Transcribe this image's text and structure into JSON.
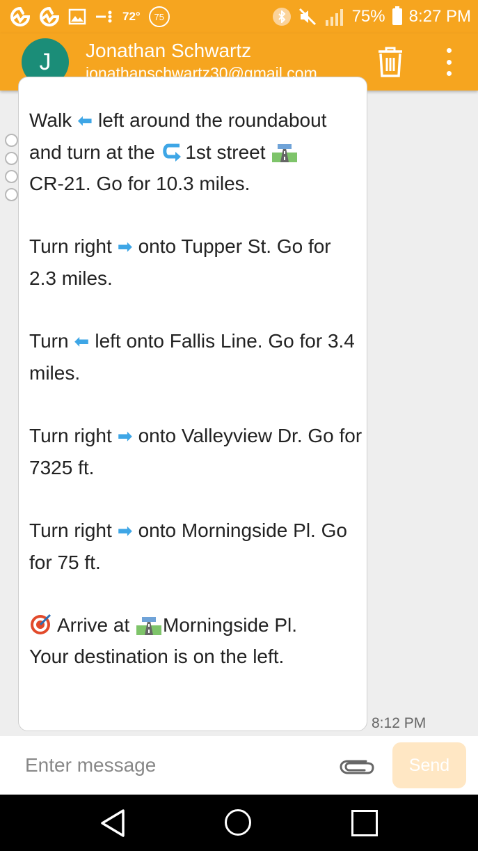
{
  "status_bar": {
    "temperature": "72°",
    "aqi": "75",
    "battery": "75%",
    "time": "8:27 PM",
    "icons": [
      "avast-icon",
      "avast-icon",
      "image-icon",
      "vpn-key-icon",
      "bluetooth-icon",
      "mute-icon",
      "signal-icon",
      "battery-icon"
    ]
  },
  "header": {
    "avatar_letter": "J",
    "contact_name": "Jonathan Schwartz",
    "contact_email": "jonathanschwartz30@gmail.com",
    "avatar_color": "#1b8d78",
    "accent_color": "#f6a51f"
  },
  "message": {
    "step1_a": "Walk",
    "step1_b": "left around the roundabout and turn at the",
    "step1_c": "1st street",
    "step1_d": "CR-21. Go for 10.3 miles.",
    "step2_a": "Turn right",
    "step2_b": "onto Tupper St. Go for 2.3 miles.",
    "step3_a": "Turn",
    "step3_b": "left onto Fallis Line. Go for 3.4 miles.",
    "step4_a": "Turn right",
    "step4_b": "onto Valleyview Dr. Go for 7325 ft.",
    "step5_a": "Turn right",
    "step5_b": "onto Morningside Pl. Go for 75 ft.",
    "arrive_a": "Arrive at",
    "arrive_b": "Morningside Pl.",
    "arrive_c": "Your destination is on the left.",
    "timestamp": "8:12 PM"
  },
  "composer": {
    "placeholder": "Enter message",
    "send_label": "Send"
  }
}
